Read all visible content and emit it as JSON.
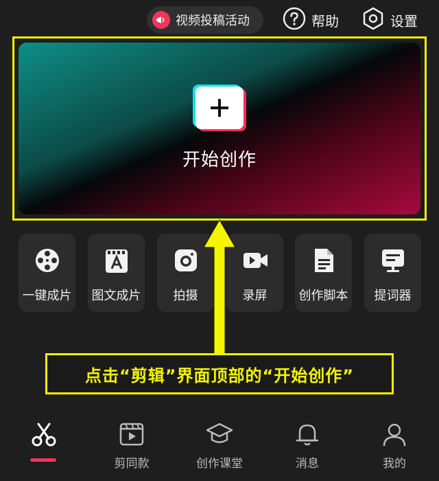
{
  "header": {
    "promo_label": "视频投稿活动",
    "help_label": "帮助",
    "settings_label": "设置"
  },
  "hero": {
    "title": "开始创作"
  },
  "tools": [
    {
      "label": "一键成片",
      "icon": "film-reel-icon"
    },
    {
      "label": "图文成片",
      "icon": "text-clip-icon"
    },
    {
      "label": "拍摄",
      "icon": "camera-icon"
    },
    {
      "label": "录屏",
      "icon": "video-camera-icon"
    },
    {
      "label": "创作脚本",
      "icon": "script-document-icon"
    },
    {
      "label": "提词器",
      "icon": "teleprompter-icon"
    }
  ],
  "annotation": {
    "text": "点击“剪辑”界面顶部的“开始创作”",
    "color": "#f5f500"
  },
  "nav": {
    "items": [
      {
        "label": "",
        "icon": "scissors-icon",
        "active": true
      },
      {
        "label": "剪同款",
        "icon": "template-clip-icon"
      },
      {
        "label": "创作课堂",
        "icon": "graduation-cap-icon"
      },
      {
        "label": "消息",
        "icon": "bell-icon"
      },
      {
        "label": "我的",
        "icon": "user-icon"
      }
    ]
  },
  "colors": {
    "background": "#1e1e1e",
    "accent": "#f0365a",
    "highlight": "#f5f500"
  }
}
